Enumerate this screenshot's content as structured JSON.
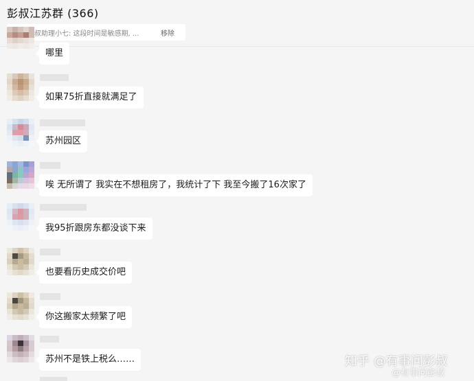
{
  "header": {
    "title": "彭叔江苏群 (366)",
    "notice_text": "彭叔助理小七: 这段时间是敏感期, ...",
    "remove_label": "移除"
  },
  "messages": [
    {
      "text": "哪里"
    },
    {
      "text": "如果75折直接就满足了"
    },
    {
      "text": "苏州园区"
    },
    {
      "text": "唉 无所谓了 我实在不想租房了，我统计了下 我至今搬了16次家了"
    },
    {
      "text": "我95折跟房东都没谈下来"
    },
    {
      "text": "也要看历史成交价吧"
    },
    {
      "text": "你这搬家太频繁了吧"
    },
    {
      "text": "苏州不是铁上税么……"
    }
  ],
  "watermark": {
    "main": "知乎 @有事问彭叔",
    "sub": "@有事问彭叔"
  },
  "colors": {
    "background": "#f5f5f5",
    "bubble": "#ffffff",
    "notice_icon": "#f3b100"
  }
}
